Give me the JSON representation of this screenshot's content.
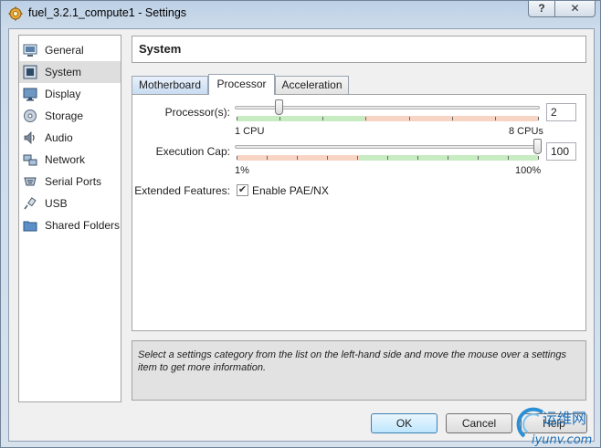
{
  "window": {
    "title": "fuel_3.2.1_compute1 - Settings",
    "help_label": "?",
    "close_label": "✕"
  },
  "sidebar": {
    "items": [
      {
        "label": "General",
        "icon": "general-icon"
      },
      {
        "label": "System",
        "icon": "system-icon",
        "selected": true
      },
      {
        "label": "Display",
        "icon": "display-icon"
      },
      {
        "label": "Storage",
        "icon": "storage-icon"
      },
      {
        "label": "Audio",
        "icon": "audio-icon"
      },
      {
        "label": "Network",
        "icon": "network-icon"
      },
      {
        "label": "Serial Ports",
        "icon": "serial-ports-icon"
      },
      {
        "label": "USB",
        "icon": "usb-icon"
      },
      {
        "label": "Shared Folders",
        "icon": "shared-folders-icon"
      }
    ]
  },
  "page": {
    "title": "System"
  },
  "tabs": [
    {
      "label": "Motherboard"
    },
    {
      "label": "Processor",
      "active": true
    },
    {
      "label": "Acceleration"
    }
  ],
  "processor": {
    "processors_label": "Processor(s):",
    "processors_value": "2",
    "processors_min_label": "1 CPU",
    "processors_max_label": "8 CPUs",
    "processors_level": 0.1429,
    "exec_cap_label": "Execution Cap:",
    "exec_cap_value": "100",
    "exec_cap_min_label": "1%",
    "exec_cap_max_label": "100%",
    "exec_cap_level": 1.0,
    "extended_label": "Extended Features:",
    "pae_label": "Enable PAE/NX",
    "pae_checked": true
  },
  "info": {
    "text": "Select a settings category from the list on the left-hand side and move the mouse over a settings item to get more information."
  },
  "buttons": {
    "ok": "OK",
    "cancel": "Cancel",
    "help": "Help"
  },
  "watermark": {
    "text_cn": "运维网",
    "text_en": "iyunv.com"
  },
  "colors": {
    "range_green": "#c7ecc1",
    "range_red": "#f7d4c4",
    "selection": "#dedede"
  }
}
